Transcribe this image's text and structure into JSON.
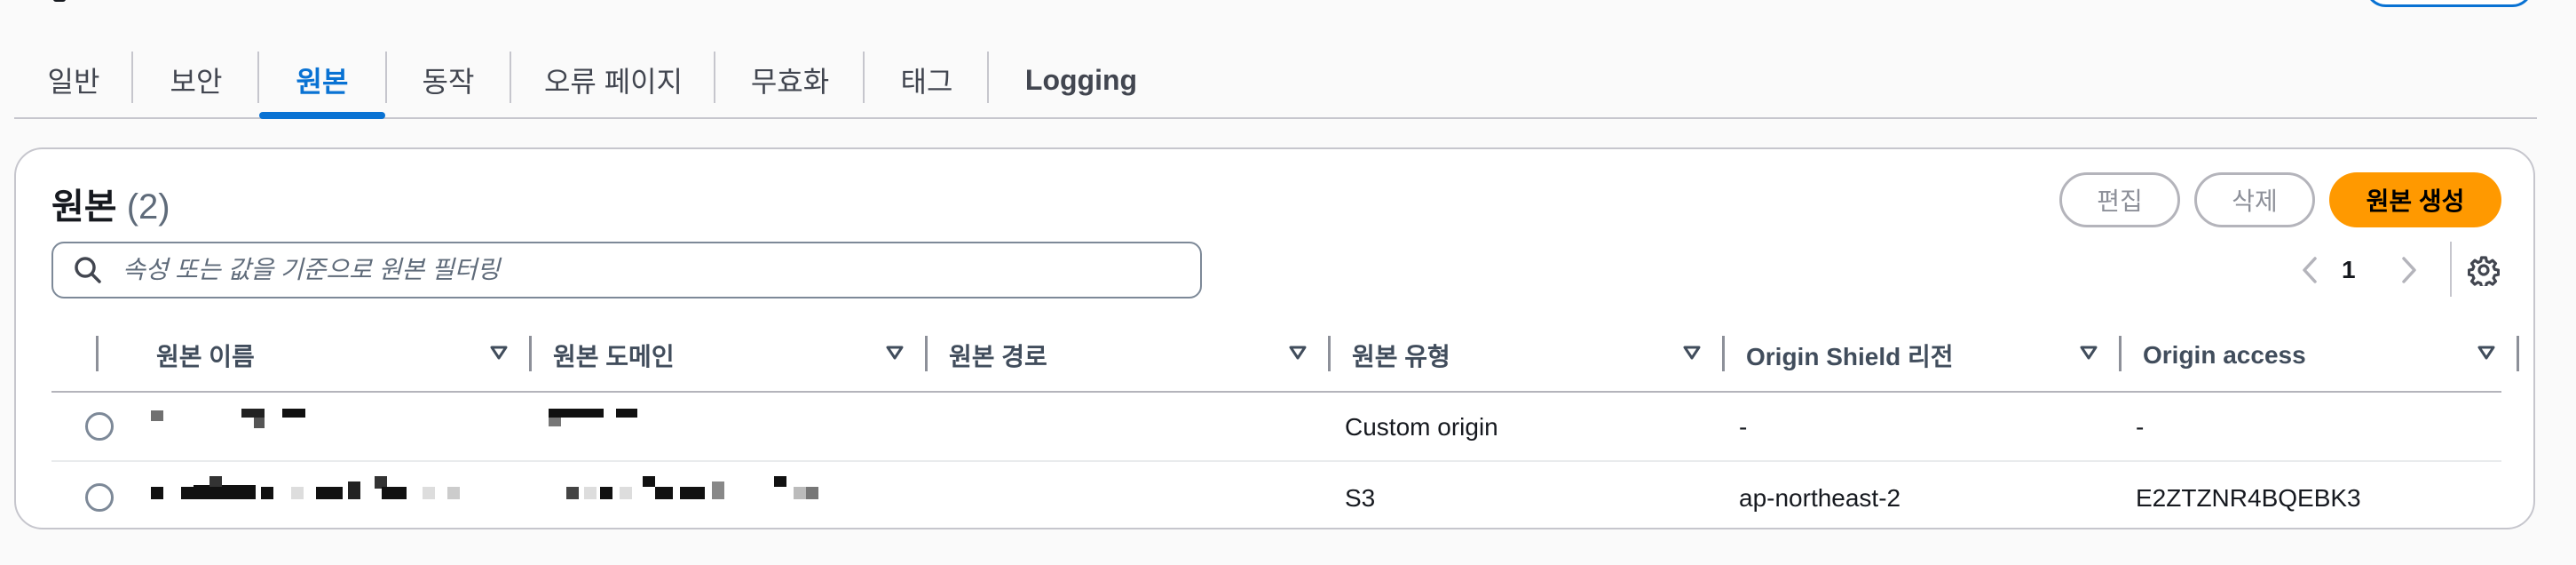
{
  "tabs": [
    {
      "label": "일반"
    },
    {
      "label": "보안"
    },
    {
      "label": "원본"
    },
    {
      "label": "동작"
    },
    {
      "label": "오류 페이지"
    },
    {
      "label": "무효화"
    },
    {
      "label": "태그"
    },
    {
      "label": "Logging"
    }
  ],
  "active_tab": "원본",
  "panel": {
    "title": "원본",
    "count": "(2)",
    "buttons": {
      "edit": "편집",
      "delete": "삭제",
      "create": "원본 생성"
    },
    "search_placeholder": "속성 또는 값을 기준으로 원본 필터링",
    "pagination": {
      "current_page": "1"
    }
  },
  "table": {
    "columns": [
      "원본 이름",
      "원본 도메인",
      "원본 경로",
      "원본 유형",
      "Origin Shield 리전",
      "Origin access"
    ],
    "rows": [
      {
        "name": "",
        "domain": "",
        "path": "",
        "type": "Custom origin",
        "shield_region": "-",
        "access": "-"
      },
      {
        "name": "",
        "domain": "",
        "path": "",
        "type": "S3",
        "shield_region": "ap-northeast-2",
        "access": "E2ZTZNR4BQEBK3"
      }
    ]
  },
  "icons": {
    "search": "search-icon",
    "prev": "chevron-left-icon",
    "next": "chevron-right-icon",
    "settings": "gear-icon",
    "sort": "caret-down-icon"
  },
  "colors": {
    "accent": "#0972d3",
    "primary_button": "#ff9900",
    "border": "#c6c6cd"
  }
}
